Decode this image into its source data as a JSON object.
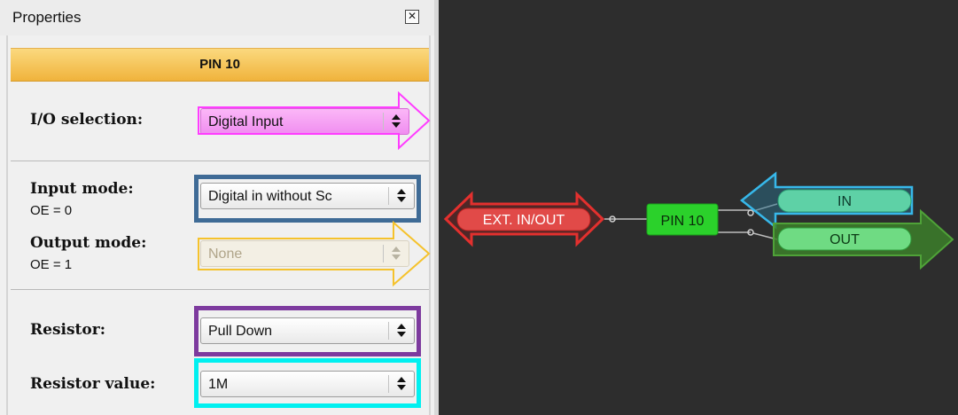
{
  "panel": {
    "title": "Properties",
    "close_glyph": "✕",
    "pin_header": "PIN 10",
    "io_selection": {
      "label": "I/O selection:",
      "value": "Digital Input"
    },
    "input_mode": {
      "label": "Input mode:",
      "sub": "OE = 0",
      "value": "Digital in without Sc"
    },
    "output_mode": {
      "label": "Output mode:",
      "sub": "OE = 1",
      "value": "None"
    },
    "resistor": {
      "label": "Resistor:",
      "value": "Pull Down"
    },
    "resistor_value": {
      "label": "Resistor value:",
      "value": "1M"
    }
  },
  "schematic": {
    "ext_label": "EXT. IN/OUT",
    "pin_label": "PIN 10",
    "in_label": "IN",
    "out_label": "OUT"
  },
  "colors": {
    "io_highlight": "#ff3cff",
    "input_mode_highlight": "#3f6b96",
    "output_mode_highlight": "#f5c22c",
    "resistor_highlight": "#7d3a9e",
    "resistor_value_highlight": "#00f0f0",
    "ext_arrow": "#e3302e",
    "in_arrow": "#37b8ea",
    "out_arrow": "#4fa238",
    "pin_block": "#2bd12b",
    "canvas_bg": "#2d2d2d"
  }
}
